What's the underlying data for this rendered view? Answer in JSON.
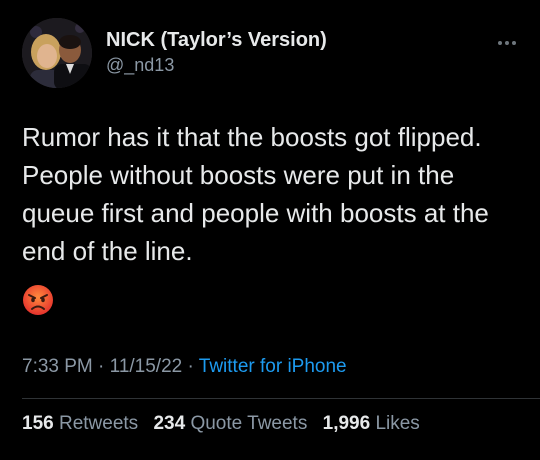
{
  "tweet": {
    "author": {
      "display_name": "NICK (Taylor’s Version)",
      "handle": "@_nd13",
      "avatar_icon": "avatar-photo"
    },
    "more_icon": "more-options-icon",
    "text": "Rumor has it that the boosts got flipped. People without boosts were put in the queue first and people with boosts at the end of the line.",
    "emoji": "😡",
    "meta": {
      "time": "7:33 PM",
      "separator": " · ",
      "date": "11/15/22",
      "source": "Twitter for iPhone"
    },
    "stats": [
      {
        "count": "156",
        "label": "Retweets"
      },
      {
        "count": "234",
        "label": "Quote Tweets"
      },
      {
        "count": "1,996",
        "label": "Likes"
      }
    ]
  },
  "colors": {
    "background": "#000000",
    "text_primary": "#e7e9ea",
    "text_secondary": "#8b98a5",
    "link": "#1d9bf0",
    "divider": "#2f3336"
  }
}
